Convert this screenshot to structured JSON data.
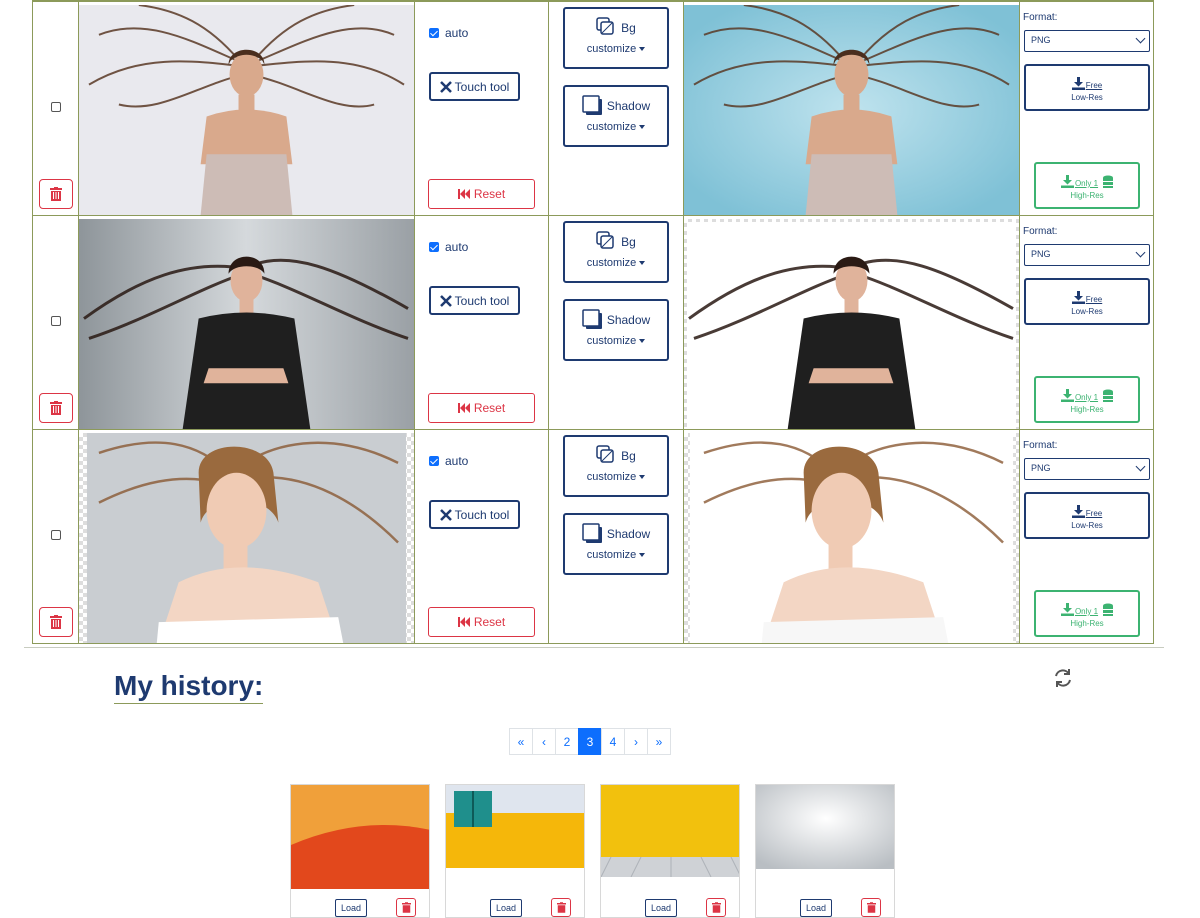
{
  "rows": [
    {
      "auto_label": "auto",
      "touch_label": "Touch tool",
      "reset_label": "Reset",
      "bg_label": "Bg",
      "bg_customize": "customize",
      "shadow_label": "Shadow",
      "shadow_customize": "customize",
      "format_label": "Format:",
      "format_value": "PNG",
      "free_label": "Free",
      "lowres_label": "Low-Res",
      "only_label": "Only 1",
      "highres_label": "High-Res"
    },
    {
      "auto_label": "auto",
      "touch_label": "Touch tool",
      "reset_label": "Reset",
      "bg_label": "Bg",
      "bg_customize": "customize",
      "shadow_label": "Shadow",
      "shadow_customize": "customize",
      "format_label": "Format:",
      "format_value": "PNG",
      "free_label": "Free",
      "lowres_label": "Low-Res",
      "only_label": "Only 1",
      "highres_label": "High-Res"
    },
    {
      "auto_label": "auto",
      "touch_label": "Touch tool",
      "reset_label": "Reset",
      "bg_label": "Bg",
      "bg_customize": "customize",
      "shadow_label": "Shadow",
      "shadow_customize": "customize",
      "format_label": "Format:",
      "format_value": "PNG",
      "free_label": "Free",
      "lowres_label": "Low-Res",
      "only_label": "Only 1",
      "highres_label": "High-Res"
    }
  ],
  "history": {
    "title": "My history:",
    "pagination": [
      "«",
      "‹",
      "2",
      "3",
      "4",
      "›",
      "»"
    ],
    "active_page": "3",
    "load_label": "Load",
    "thumb_colors": [
      "#e2481c",
      "#f5b70a",
      "#f2c10d",
      "#e3e6e8"
    ]
  },
  "colors": {
    "primary": "#1e3a70",
    "danger": "#dc3545",
    "success": "#3cb371",
    "link": "#0d6efd"
  }
}
